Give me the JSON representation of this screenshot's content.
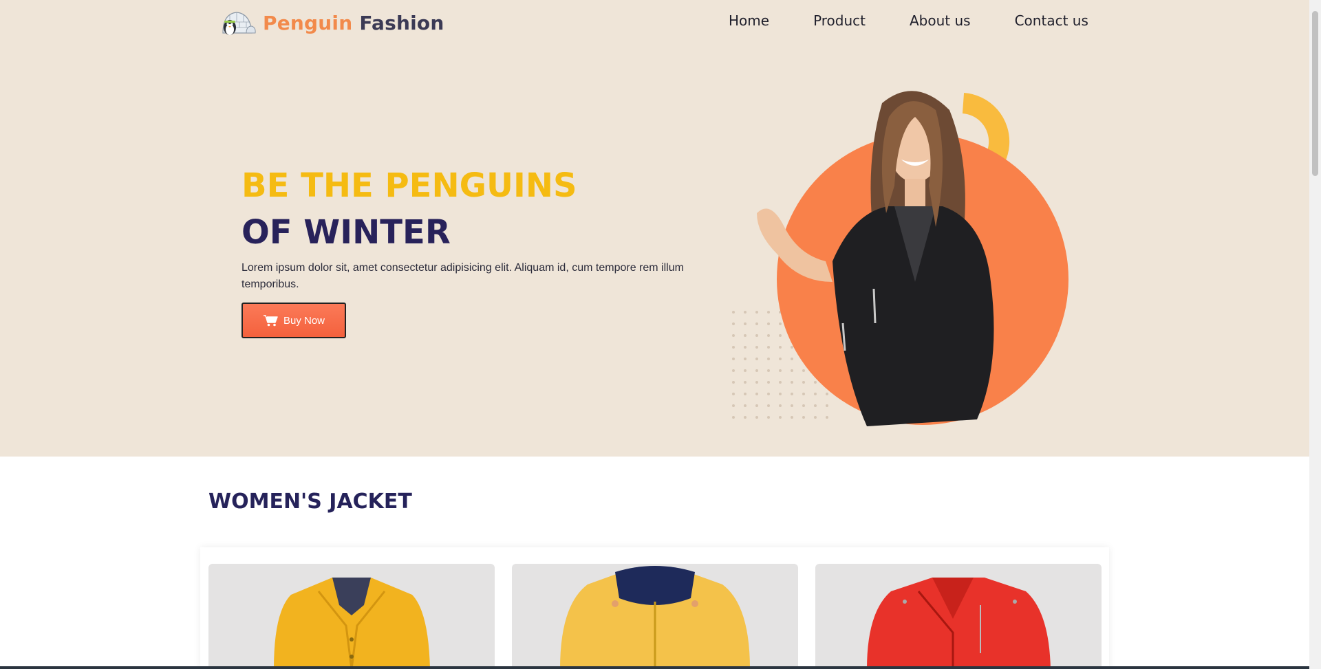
{
  "brand": {
    "name_part1": "Penguin",
    "name_part2": "Fashion"
  },
  "nav": {
    "items": [
      "Home",
      "Product",
      "About us",
      "Contact us"
    ]
  },
  "hero": {
    "headline_line1": "BE THE PENGUINS",
    "headline_line2": "OF WINTER",
    "body": "Lorem ipsum dolor sit, amet consectetur adipisicing elit. Aliquam id, cum tempore rem illum temporibus.",
    "cta_label": "Buy Now"
  },
  "section": {
    "title": "WOMEN'S JACKET"
  },
  "products": [
    {
      "color": "#f2b31f"
    },
    {
      "color": "#f4c24a"
    },
    {
      "color": "#e8322a"
    }
  ],
  "colors": {
    "hero_bg": "#efe5d8",
    "accent_yellow": "#f5bb12",
    "accent_navy": "#28225a",
    "accent_orange": "#f9814a"
  },
  "icons": {
    "cart": "cart-icon",
    "logo": "penguin-igloo-logo-icon"
  }
}
